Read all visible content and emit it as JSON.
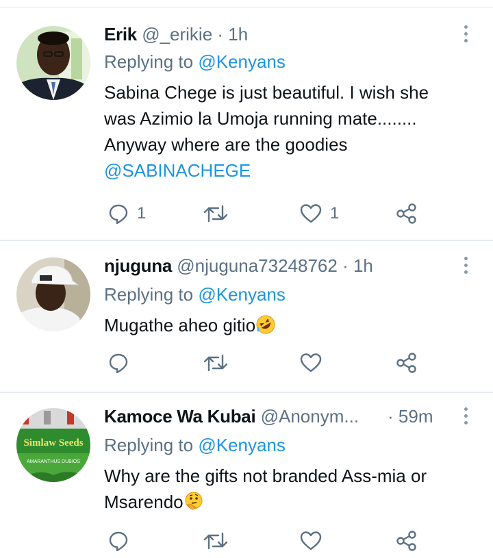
{
  "tweets": [
    {
      "name": "Erik",
      "handle": "@_erikie",
      "time": "1h",
      "replying_label": "Replying to ",
      "replying_to": "@Kenyans",
      "text_line1": "Sabina Chege is just beautiful. I wish she",
      "text_line2": "was Azimio la Umoja running mate........",
      "text_line3": "Anyway where are the goodies",
      "mention": "@SABINACHEGE",
      "reply_count": "1",
      "retweet_count": "",
      "like_count": "1"
    },
    {
      "name": "njuguna",
      "handle": "@njuguna73248762",
      "time": "1h",
      "replying_label": "Replying to ",
      "replying_to": "@Kenyans",
      "text_line1": "Mugathe aheo gitio",
      "emoji": "rolling-on-floor-laughing-emoji",
      "reply_count": "",
      "retweet_count": "",
      "like_count": ""
    },
    {
      "name": "Kamoce Wa Kubai",
      "handle": "@Anonym...",
      "time": "59m",
      "replying_label": "Replying to ",
      "replying_to": "@Kenyans",
      "text_line1": "Why are the gifts not branded Ass-mia or",
      "text_line2": "Msarendo",
      "emoji": "thinking-face-emoji",
      "avatar_text1": "Simlaw Seeds",
      "avatar_text2": "AMARANTHUS DUBIOS",
      "reply_count": "",
      "retweet_count": "",
      "like_count": ""
    }
  ],
  "separator": " · ",
  "colors": {
    "link": "#1b95e0",
    "secondary": "#5b7083",
    "divider": "#e6ecf0"
  }
}
